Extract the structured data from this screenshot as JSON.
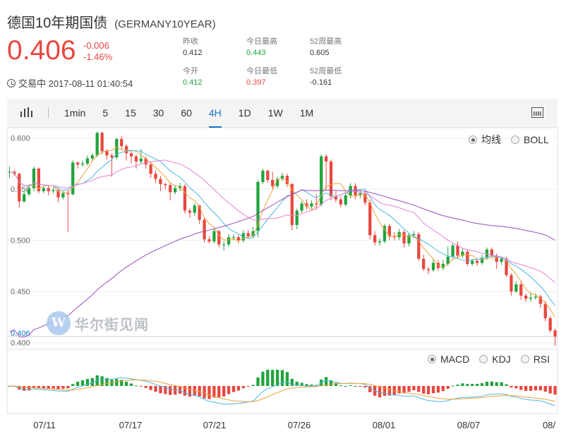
{
  "header": {
    "name_cn": "德国10年期国债",
    "code": "(GERMANY10YEAR)",
    "price": "0.406",
    "change_abs": "-0.006",
    "change_pct": "-1.46%",
    "status": "交易中 2017-08-11 01:40:54"
  },
  "stats": {
    "prev_close_label": "昨收",
    "prev_close": "0.412",
    "open_label": "今开",
    "open": "0.412",
    "high_label": "今日最高",
    "high": "0.443",
    "low_label": "今日最低",
    "low": "0.397",
    "w52_high_label": "52周最高",
    "w52_high": "0.605",
    "w52_low_label": "52周最低",
    "w52_low": "-0.161"
  },
  "toolbar": {
    "timeframes": [
      "1min",
      "5",
      "15",
      "30",
      "60",
      "4H",
      "1D",
      "1W",
      "1M"
    ],
    "active": "4H"
  },
  "overlay_options": {
    "ma": "均线",
    "boll": "BOLL",
    "selected": "均线"
  },
  "indicator_options": {
    "macd": "MACD",
    "kdj": "KDJ",
    "rsi": "RSI",
    "selected": "MACD"
  },
  "watermark": {
    "text": "华尔街见闻"
  },
  "colors": {
    "up": "#e8473f",
    "down": "#21a43c",
    "accent": "#1a73c9"
  },
  "chart_data": {
    "type": "candlestick",
    "y_ticks": [
      "0.600",
      "0.550",
      "0.500",
      "0.450",
      "0.400"
    ],
    "ylim": [
      0.395,
      0.61
    ],
    "x_ticks": [
      "07/11",
      "07/17",
      "07/21",
      "07/26",
      "08/01",
      "08/07",
      "08/"
    ],
    "last_price_label": "0.406",
    "candles": [
      [
        0.567,
        0.567,
        0.572,
        0.561
      ],
      [
        0.567,
        0.565,
        0.569,
        0.563
      ],
      [
        0.565,
        0.538,
        0.566,
        0.532
      ],
      [
        0.538,
        0.545,
        0.548,
        0.537
      ],
      [
        0.545,
        0.551,
        0.555,
        0.543
      ],
      [
        0.551,
        0.57,
        0.572,
        0.548
      ],
      [
        0.57,
        0.548,
        0.571,
        0.546
      ],
      [
        0.548,
        0.551,
        0.553,
        0.546
      ],
      [
        0.551,
        0.548,
        0.554,
        0.544
      ],
      [
        0.548,
        0.549,
        0.552,
        0.546
      ],
      [
        0.549,
        0.542,
        0.551,
        0.537
      ],
      [
        0.542,
        0.546,
        0.548,
        0.54
      ],
      [
        0.546,
        0.545,
        0.549,
        0.508
      ],
      [
        0.545,
        0.576,
        0.578,
        0.544
      ],
      [
        0.576,
        0.574,
        0.577,
        0.57
      ],
      [
        0.574,
        0.575,
        0.578,
        0.572
      ],
      [
        0.575,
        0.58,
        0.583,
        0.573
      ],
      [
        0.58,
        0.583,
        0.585,
        0.578
      ],
      [
        0.583,
        0.605,
        0.606,
        0.581
      ],
      [
        0.605,
        0.587,
        0.606,
        0.584
      ],
      [
        0.587,
        0.583,
        0.589,
        0.579
      ],
      [
        0.583,
        0.581,
        0.585,
        0.562
      ],
      [
        0.581,
        0.599,
        0.6,
        0.579
      ],
      [
        0.599,
        0.592,
        0.602,
        0.589
      ],
      [
        0.592,
        0.585,
        0.594,
        0.578
      ],
      [
        0.585,
        0.582,
        0.588,
        0.575
      ],
      [
        0.582,
        0.577,
        0.584,
        0.57
      ],
      [
        0.577,
        0.58,
        0.589,
        0.575
      ],
      [
        0.58,
        0.574,
        0.582,
        0.57
      ],
      [
        0.574,
        0.565,
        0.576,
        0.561
      ],
      [
        0.565,
        0.56,
        0.568,
        0.556
      ],
      [
        0.56,
        0.555,
        0.563,
        0.548
      ],
      [
        0.555,
        0.554,
        0.556,
        0.55
      ],
      [
        0.554,
        0.547,
        0.556,
        0.539
      ],
      [
        0.547,
        0.551,
        0.554,
        0.545
      ],
      [
        0.551,
        0.553,
        0.556,
        0.548
      ],
      [
        0.553,
        0.529,
        0.555,
        0.526
      ],
      [
        0.529,
        0.527,
        0.531,
        0.522
      ],
      [
        0.527,
        0.534,
        0.536,
        0.524
      ],
      [
        0.534,
        0.52,
        0.535,
        0.516
      ],
      [
        0.52,
        0.501,
        0.522,
        0.498
      ],
      [
        0.501,
        0.499,
        0.504,
        0.497
      ],
      [
        0.499,
        0.509,
        0.511,
        0.497
      ],
      [
        0.509,
        0.496,
        0.51,
        0.493
      ],
      [
        0.496,
        0.496,
        0.499,
        0.49
      ],
      [
        0.496,
        0.503,
        0.506,
        0.494
      ],
      [
        0.503,
        0.503,
        0.506,
        0.5
      ],
      [
        0.503,
        0.5,
        0.505,
        0.497
      ],
      [
        0.5,
        0.507,
        0.51,
        0.498
      ],
      [
        0.507,
        0.504,
        0.51,
        0.502
      ],
      [
        0.504,
        0.509,
        0.513,
        0.503
      ],
      [
        0.509,
        0.557,
        0.559,
        0.503
      ],
      [
        0.557,
        0.568,
        0.57,
        0.555
      ],
      [
        0.568,
        0.559,
        0.569,
        0.556
      ],
      [
        0.559,
        0.553,
        0.567,
        0.55
      ],
      [
        0.553,
        0.56,
        0.562,
        0.551
      ],
      [
        0.56,
        0.563,
        0.566,
        0.558
      ],
      [
        0.563,
        0.555,
        0.565,
        0.552
      ],
      [
        0.555,
        0.515,
        0.556,
        0.51
      ],
      [
        0.515,
        0.529,
        0.531,
        0.511
      ],
      [
        0.529,
        0.536,
        0.538,
        0.527
      ],
      [
        0.536,
        0.533,
        0.54,
        0.53
      ],
      [
        0.533,
        0.536,
        0.539,
        0.531
      ],
      [
        0.536,
        0.535,
        0.545,
        0.53
      ],
      [
        0.535,
        0.582,
        0.584,
        0.533
      ],
      [
        0.582,
        0.577,
        0.584,
        0.55
      ],
      [
        0.577,
        0.543,
        0.579,
        0.539
      ],
      [
        0.543,
        0.54,
        0.548,
        0.537
      ],
      [
        0.54,
        0.535,
        0.543,
        0.532
      ],
      [
        0.535,
        0.544,
        0.546,
        0.533
      ],
      [
        0.544,
        0.553,
        0.556,
        0.541
      ],
      [
        0.553,
        0.544,
        0.556,
        0.54
      ],
      [
        0.544,
        0.546,
        0.549,
        0.541
      ],
      [
        0.546,
        0.537,
        0.548,
        0.534
      ],
      [
        0.537,
        0.505,
        0.539,
        0.501
      ],
      [
        0.505,
        0.498,
        0.509,
        0.495
      ],
      [
        0.498,
        0.499,
        0.502,
        0.495
      ],
      [
        0.499,
        0.514,
        0.516,
        0.497
      ],
      [
        0.514,
        0.504,
        0.516,
        0.5
      ],
      [
        0.504,
        0.503,
        0.508,
        0.5
      ],
      [
        0.503,
        0.508,
        0.511,
        0.5
      ],
      [
        0.508,
        0.497,
        0.51,
        0.493
      ],
      [
        0.497,
        0.505,
        0.507,
        0.494
      ],
      [
        0.505,
        0.506,
        0.509,
        0.502
      ],
      [
        0.506,
        0.482,
        0.508,
        0.48
      ],
      [
        0.482,
        0.472,
        0.486,
        0.47
      ],
      [
        0.472,
        0.471,
        0.474,
        0.467
      ],
      [
        0.471,
        0.478,
        0.481,
        0.469
      ],
      [
        0.478,
        0.473,
        0.481,
        0.47
      ],
      [
        0.473,
        0.477,
        0.481,
        0.471
      ],
      [
        0.477,
        0.484,
        0.494,
        0.475
      ],
      [
        0.484,
        0.495,
        0.497,
        0.482
      ],
      [
        0.495,
        0.485,
        0.499,
        0.482
      ],
      [
        0.485,
        0.489,
        0.492,
        0.483
      ],
      [
        0.489,
        0.477,
        0.491,
        0.475
      ],
      [
        0.477,
        0.48,
        0.482,
        0.475
      ],
      [
        0.48,
        0.478,
        0.482,
        0.475
      ],
      [
        0.478,
        0.483,
        0.486,
        0.476
      ],
      [
        0.483,
        0.491,
        0.493,
        0.481
      ],
      [
        0.491,
        0.485,
        0.493,
        0.483
      ],
      [
        0.485,
        0.479,
        0.487,
        0.472
      ],
      [
        0.479,
        0.482,
        0.484,
        0.476
      ],
      [
        0.482,
        0.466,
        0.484,
        0.464
      ],
      [
        0.466,
        0.45,
        0.468,
        0.446
      ],
      [
        0.45,
        0.457,
        0.46,
        0.449
      ],
      [
        0.457,
        0.446,
        0.46,
        0.442
      ],
      [
        0.446,
        0.443,
        0.448,
        0.44
      ],
      [
        0.443,
        0.444,
        0.449,
        0.44
      ],
      [
        0.444,
        0.445,
        0.448,
        0.442
      ],
      [
        0.445,
        0.438,
        0.447,
        0.434
      ],
      [
        0.438,
        0.424,
        0.441,
        0.421
      ],
      [
        0.424,
        0.412,
        0.426,
        0.41
      ],
      [
        0.412,
        0.406,
        0.414,
        0.397
      ]
    ]
  }
}
